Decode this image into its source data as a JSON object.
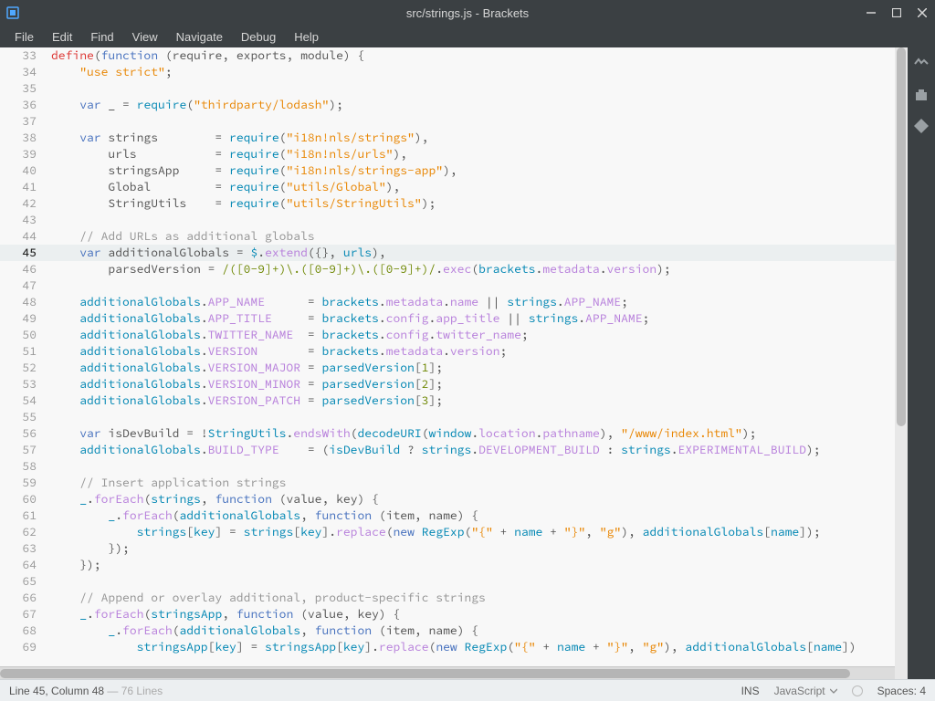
{
  "window": {
    "title": "src/strings.js - Brackets"
  },
  "menu": [
    "File",
    "Edit",
    "Find",
    "View",
    "Navigate",
    "Debug",
    "Help"
  ],
  "status": {
    "cursor": "Line 45, Column 48",
    "total": " — 76 Lines",
    "ins": "INS",
    "lang": "JavaScript",
    "spaces": "Spaces: 4"
  },
  "active_line": 45,
  "lines": [
    {
      "n": 33,
      "html": "<span class='t-red'>define</span>(<span class='kw'>function</span> (<span class='def'>require</span>, <span class='def'>exports</span>, <span class='def'>module</span>) {"
    },
    {
      "n": 34,
      "html": "    <span class='str'>\"use strict\"</span>;"
    },
    {
      "n": 35,
      "html": ""
    },
    {
      "n": 36,
      "html": "    <span class='kw'>var</span> <span class='def'>_</span> = <span class='var2'>require</span>(<span class='str'>\"thirdparty/lodash\"</span>);"
    },
    {
      "n": 37,
      "html": ""
    },
    {
      "n": 38,
      "html": "    <span class='kw'>var</span> <span class='def'>strings</span>        = <span class='var2'>require</span>(<span class='str'>\"i18n!nls/strings\"</span>),"
    },
    {
      "n": 39,
      "html": "        <span class='def'>urls</span>           = <span class='var2'>require</span>(<span class='str'>\"i18n!nls/urls\"</span>),"
    },
    {
      "n": 40,
      "html": "        <span class='def'>stringsApp</span>     = <span class='var2'>require</span>(<span class='str'>\"i18n!nls/strings-app\"</span>),"
    },
    {
      "n": 41,
      "html": "        <span class='def'>Global</span>         = <span class='var2'>require</span>(<span class='str'>\"utils/Global\"</span>),"
    },
    {
      "n": 42,
      "html": "        <span class='def'>StringUtils</span>    = <span class='var2'>require</span>(<span class='str'>\"utils/StringUtils\"</span>);"
    },
    {
      "n": 43,
      "html": ""
    },
    {
      "n": 44,
      "html": "    <span class='cm'>// Add URLs as additional globals</span>"
    },
    {
      "n": 45,
      "html": "    <span class='kw'>var</span> <span class='def'>additionalGlobals</span> = <span class='var2'>$</span>.<span class='prop'>extend</span>({}, <span class='var2'>urls</span>),"
    },
    {
      "n": 46,
      "html": "        <span class='def'>parsedVersion</span> = <span class='rx'>/([0-9]+)\\.([0-9]+)\\.([0-9]+)/</span>.<span class='prop'>exec</span>(<span class='var2'>brackets</span>.<span class='prop'>metadata</span>.<span class='prop'>version</span>);"
    },
    {
      "n": 47,
      "html": ""
    },
    {
      "n": 48,
      "html": "    <span class='var2'>additionalGlobals</span>.<span class='prop'>APP_NAME</span>      = <span class='var2'>brackets</span>.<span class='prop'>metadata</span>.<span class='prop'>name</span> || <span class='var2'>strings</span>.<span class='prop'>APP_NAME</span>;"
    },
    {
      "n": 49,
      "html": "    <span class='var2'>additionalGlobals</span>.<span class='prop'>APP_TITLE</span>     = <span class='var2'>brackets</span>.<span class='prop'>config</span>.<span class='prop'>app_title</span> || <span class='var2'>strings</span>.<span class='prop'>APP_NAME</span>;"
    },
    {
      "n": 50,
      "html": "    <span class='var2'>additionalGlobals</span>.<span class='prop'>TWITTER_NAME</span>  = <span class='var2'>brackets</span>.<span class='prop'>config</span>.<span class='prop'>twitter_name</span>;"
    },
    {
      "n": 51,
      "html": "    <span class='var2'>additionalGlobals</span>.<span class='prop'>VERSION</span>       = <span class='var2'>brackets</span>.<span class='prop'>metadata</span>.<span class='prop'>version</span>;"
    },
    {
      "n": 52,
      "html": "    <span class='var2'>additionalGlobals</span>.<span class='prop'>VERSION_MAJOR</span> = <span class='var2'>parsedVersion</span>[<span class='num'>1</span>];"
    },
    {
      "n": 53,
      "html": "    <span class='var2'>additionalGlobals</span>.<span class='prop'>VERSION_MINOR</span> = <span class='var2'>parsedVersion</span>[<span class='num'>2</span>];"
    },
    {
      "n": 54,
      "html": "    <span class='var2'>additionalGlobals</span>.<span class='prop'>VERSION_PATCH</span> = <span class='var2'>parsedVersion</span>[<span class='num'>3</span>];"
    },
    {
      "n": 55,
      "html": ""
    },
    {
      "n": 56,
      "html": "    <span class='kw'>var</span> <span class='def'>isDevBuild</span> = !<span class='var2'>StringUtils</span>.<span class='prop'>endsWith</span>(<span class='var2'>decodeURI</span>(<span class='var2'>window</span>.<span class='prop'>location</span>.<span class='prop'>pathname</span>), <span class='str'>\"/www/index.html\"</span>);"
    },
    {
      "n": 57,
      "html": "    <span class='var2'>additionalGlobals</span>.<span class='prop'>BUILD_TYPE</span>    = (<span class='var2'>isDevBuild</span> ? <span class='var2'>strings</span>.<span class='prop'>DEVELOPMENT_BUILD</span> : <span class='var2'>strings</span>.<span class='prop'>EXPERIMENTAL_BUILD</span>);"
    },
    {
      "n": 58,
      "html": ""
    },
    {
      "n": 59,
      "html": "    <span class='cm'>// Insert application strings</span>"
    },
    {
      "n": 60,
      "html": "    <span class='var2'>_</span>.<span class='prop'>forEach</span>(<span class='var2'>strings</span>, <span class='kw'>function</span> (<span class='def'>value</span>, <span class='def'>key</span>) {"
    },
    {
      "n": 61,
      "html": "        <span class='var2'>_</span>.<span class='prop'>forEach</span>(<span class='var2'>additionalGlobals</span>, <span class='kw'>function</span> (<span class='def'>item</span>, <span class='def'>name</span>) {"
    },
    {
      "n": 62,
      "html": "            <span class='var2'>strings</span>[<span class='var2'>key</span>] = <span class='var2'>strings</span>[<span class='var2'>key</span>].<span class='prop'>replace</span>(<span class='kw'>new</span> <span class='var2'>RegExp</span>(<span class='str'>\"{\"</span> + <span class='var2'>name</span> + <span class='str'>\"}\"</span>, <span class='str'>\"g\"</span>), <span class='var2'>additionalGlobals</span>[<span class='var2'>name</span>]);"
    },
    {
      "n": 63,
      "html": "        });"
    },
    {
      "n": 64,
      "html": "    });"
    },
    {
      "n": 65,
      "html": ""
    },
    {
      "n": 66,
      "html": "    <span class='cm'>// Append or overlay additional, product-specific strings</span>"
    },
    {
      "n": 67,
      "html": "    <span class='var2'>_</span>.<span class='prop'>forEach</span>(<span class='var2'>stringsApp</span>, <span class='kw'>function</span> (<span class='def'>value</span>, <span class='def'>key</span>) {"
    },
    {
      "n": 68,
      "html": "        <span class='var2'>_</span>.<span class='prop'>forEach</span>(<span class='var2'>additionalGlobals</span>, <span class='kw'>function</span> (<span class='def'>item</span>, <span class='def'>name</span>) {"
    },
    {
      "n": 69,
      "html": "            <span class='var2'>stringsApp</span>[<span class='var2'>key</span>] = <span class='var2'>stringsApp</span>[<span class='var2'>key</span>].<span class='prop'>replace</span>(<span class='kw'>new</span> <span class='var2'>RegExp</span>(<span class='str'>\"{\"</span> + <span class='var2'>name</span> + <span class='str'>\"}\"</span>, <span class='str'>\"g\"</span>), <span class='var2'>additionalGlobals</span>[<span class='var2'>name</span>])"
    }
  ]
}
